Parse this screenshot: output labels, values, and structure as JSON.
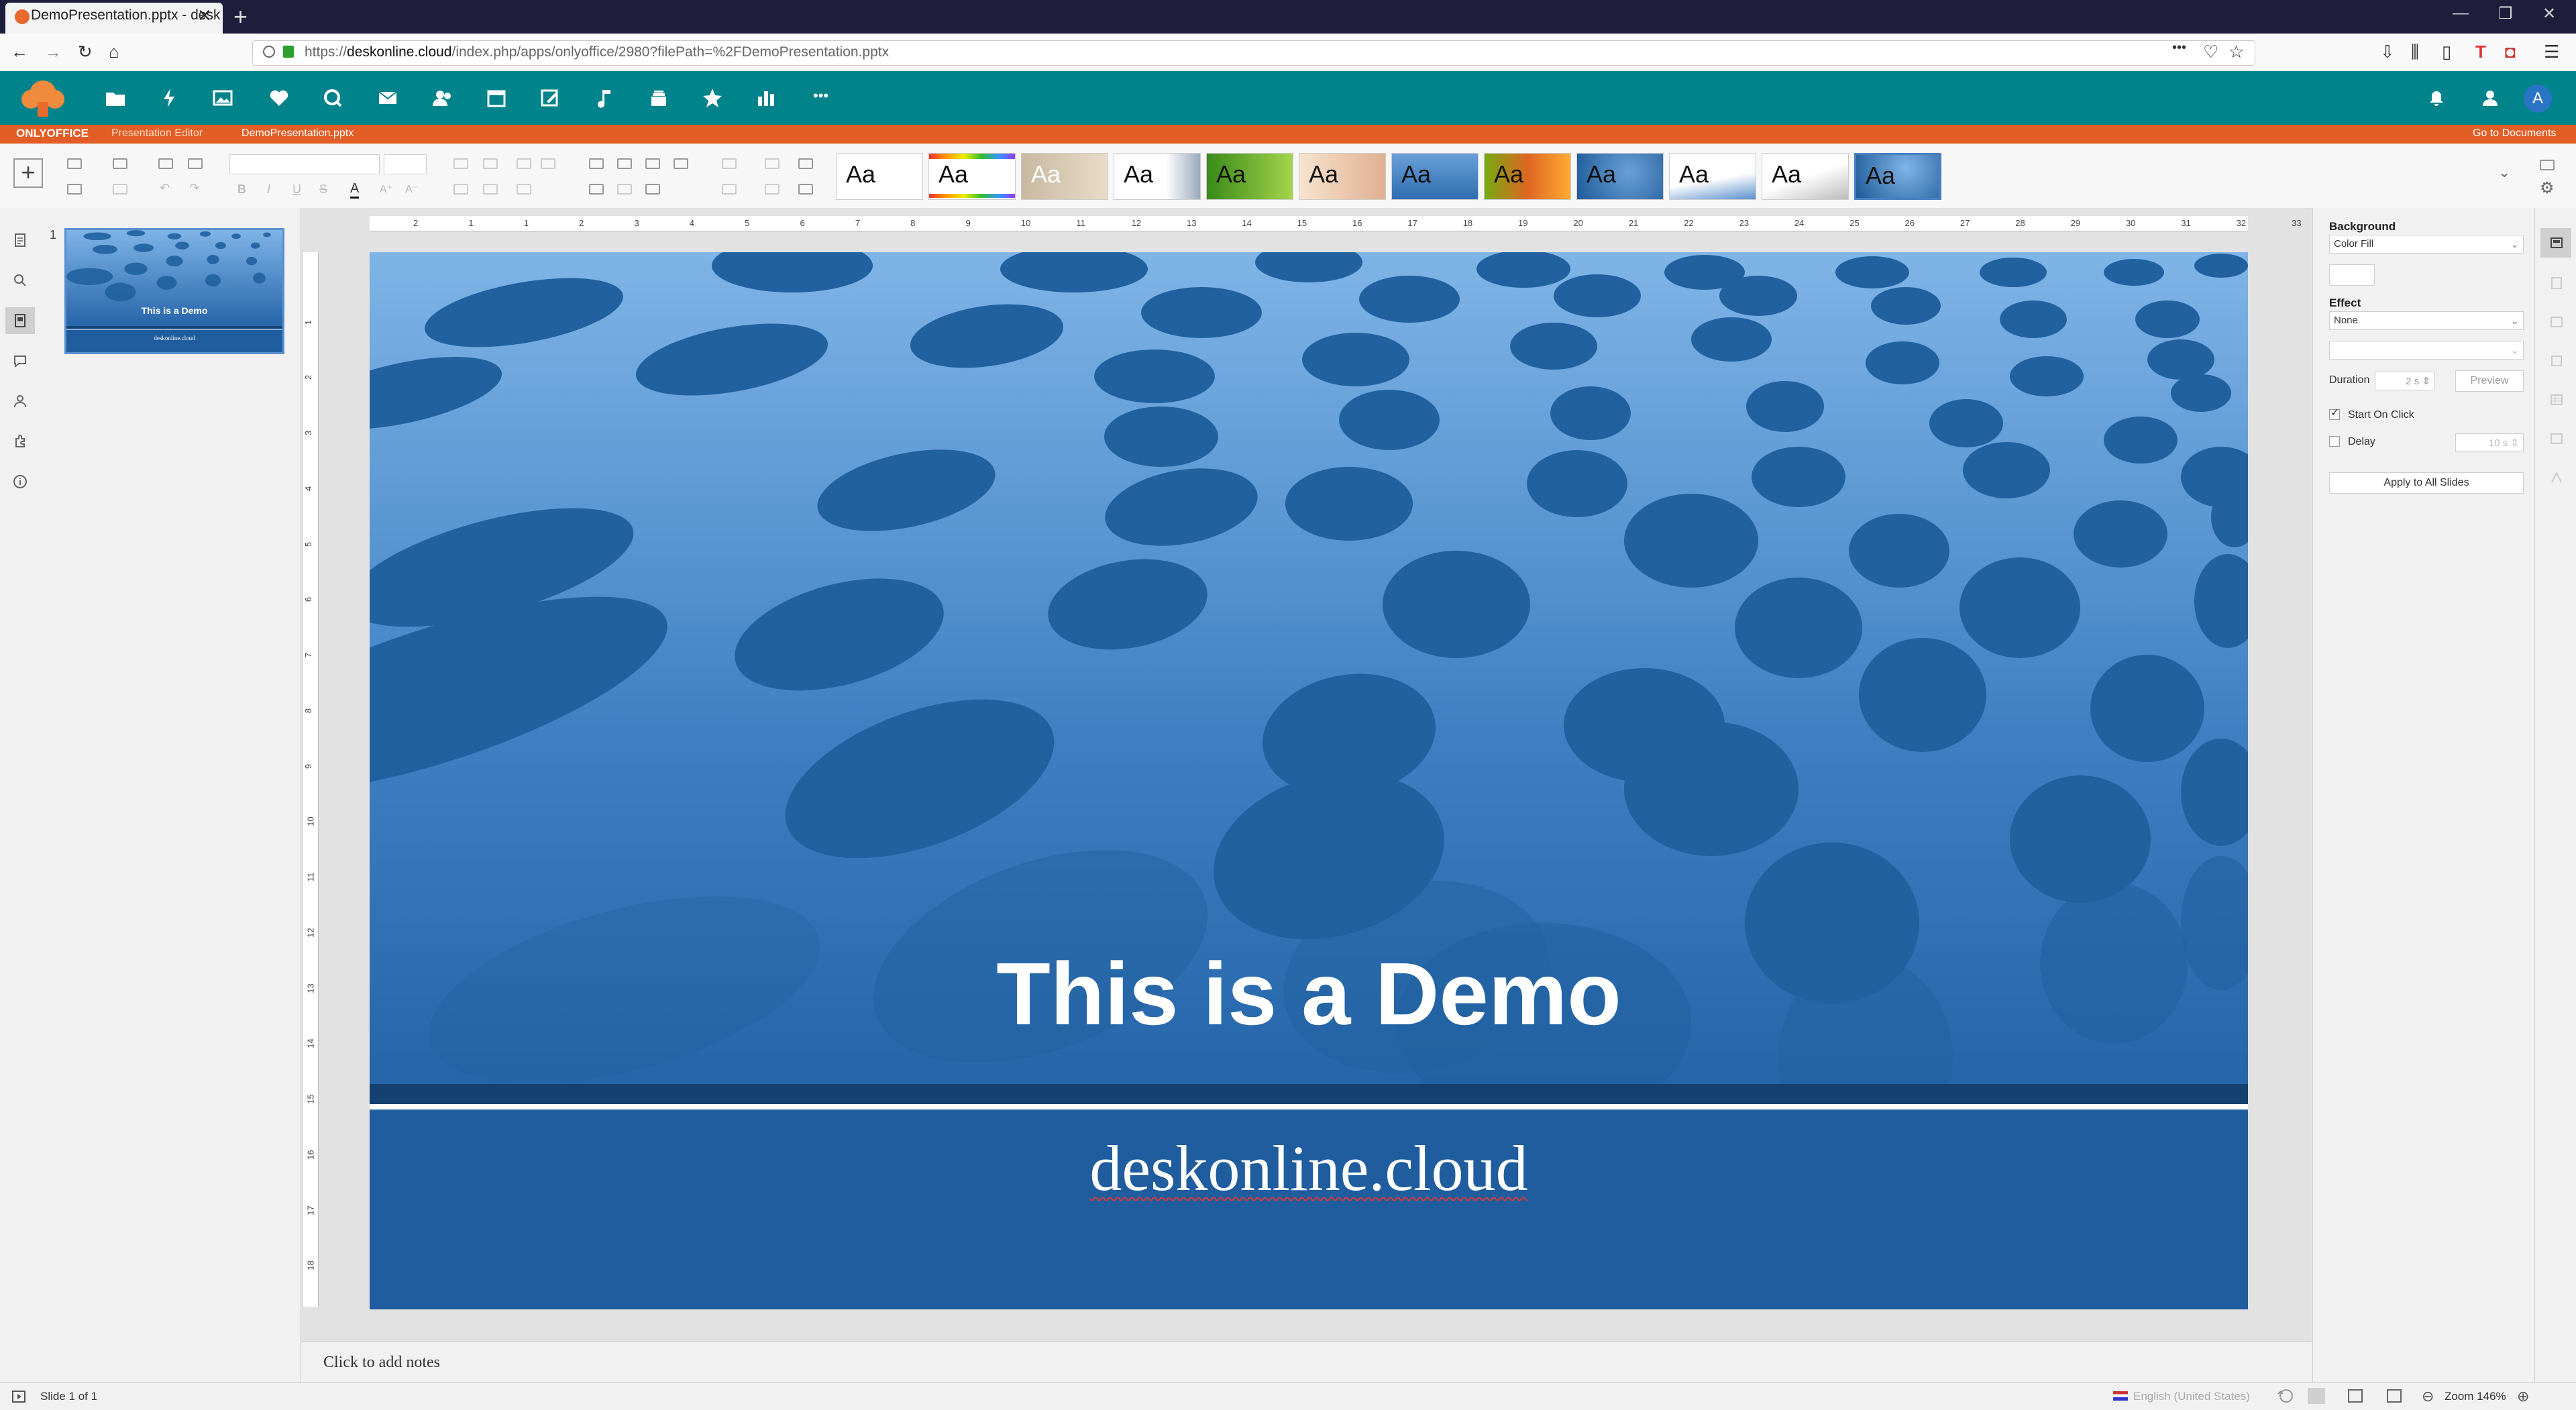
{
  "browser": {
    "tab_title": "DemoPresentation.pptx - desk",
    "url_prefix": "https://",
    "url_host": "deskonline.cloud",
    "url_path": "/index.php/apps/onlyoffice/2980?filePath=%2FDemoPresentation.pptx",
    "new_tab": "+",
    "close": "✕",
    "menu_dots": "•••"
  },
  "onlyoffice": {
    "brand": "ONLYOFFICE",
    "editor": "Presentation Editor",
    "filename": "DemoPresentation.pptx",
    "go_to_documents": "Go to Documents"
  },
  "header": {
    "more": "•••",
    "avatar": "A"
  },
  "themes": [
    {
      "label": "Aa"
    },
    {
      "label": "Aa"
    },
    {
      "label": "Aa"
    },
    {
      "label": "Aa"
    },
    {
      "label": "Aa"
    },
    {
      "label": "Aa"
    },
    {
      "label": "Aa"
    },
    {
      "label": "Aa"
    },
    {
      "label": "Aa"
    },
    {
      "label": "Aa"
    },
    {
      "label": "Aa"
    },
    {
      "label": "Aa"
    }
  ],
  "slide": {
    "number": "1",
    "title": "This is a Demo",
    "subtitle": "deskonline.cloud",
    "notes_placeholder": "Click to add notes"
  },
  "ruler": {
    "h_ticks": [
      "2",
      "1",
      "1",
      "2",
      "3",
      "4",
      "5",
      "6",
      "7",
      "8",
      "9",
      "10",
      "11",
      "12",
      "13",
      "14",
      "15",
      "16",
      "17",
      "18",
      "19",
      "20",
      "21",
      "22",
      "23",
      "24",
      "25",
      "26",
      "27",
      "28",
      "29",
      "30",
      "31",
      "32",
      "33"
    ],
    "v_ticks": [
      "1",
      "2",
      "3",
      "4",
      "5",
      "6",
      "7",
      "8",
      "9",
      "10",
      "11",
      "12",
      "13",
      "14",
      "15",
      "16",
      "17",
      "18"
    ]
  },
  "right_panel": {
    "background_label": "Background",
    "background_value": "Color Fill",
    "effect_label": "Effect",
    "effect_value": "None",
    "duration_label": "Duration",
    "duration_value": "2 s",
    "preview_button": "Preview",
    "start_on_click": "Start On Click",
    "delay_label": "Delay",
    "delay_value": "10 s",
    "apply_all": "Apply to All Slides"
  },
  "status": {
    "slide_of": "Slide 1 of 1",
    "language": "English (United States)",
    "zoom": "Zoom 146%"
  },
  "colors": {
    "nextcloud_teal": "#00838a",
    "onlyoffice_orange": "#e35d26",
    "slide_blue_top": "#7fb4e6",
    "slide_blue_bottom": "#2060a4",
    "dot_blue": "#2161a0"
  },
  "thumbnail": {
    "title": "This is a Demo",
    "subtitle": "deskonline.cloud"
  }
}
